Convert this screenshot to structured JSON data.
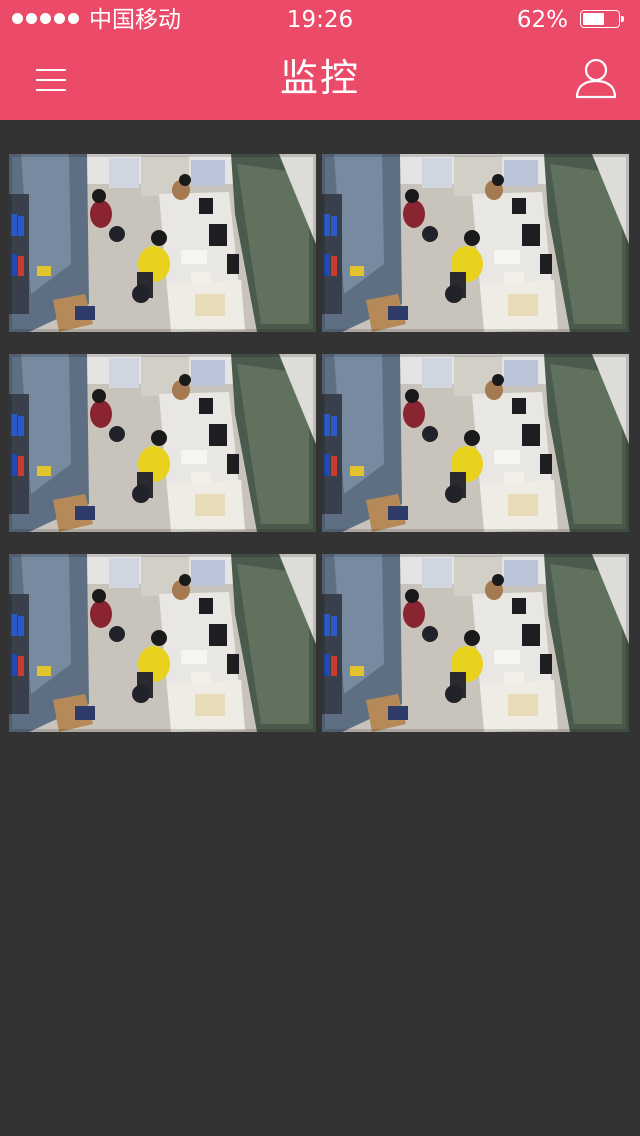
{
  "status_bar": {
    "carrier": "中国移动",
    "time": "19:26",
    "battery_percent": "62%",
    "battery_level": 0.62,
    "signal_bars": 5
  },
  "header": {
    "title": "监控",
    "menu_icon": "hamburger-menu-icon",
    "user_icon": "user-profile-icon",
    "background_color": "#eb4a69"
  },
  "cameras": [
    {
      "feed": "office-surveillance-feed"
    },
    {
      "feed": "office-surveillance-feed"
    },
    {
      "feed": "office-surveillance-feed"
    },
    {
      "feed": "office-surveillance-feed"
    },
    {
      "feed": "office-surveillance-feed"
    },
    {
      "feed": "office-surveillance-feed"
    }
  ],
  "colors": {
    "accent": "#eb4a69",
    "background": "#333333"
  }
}
